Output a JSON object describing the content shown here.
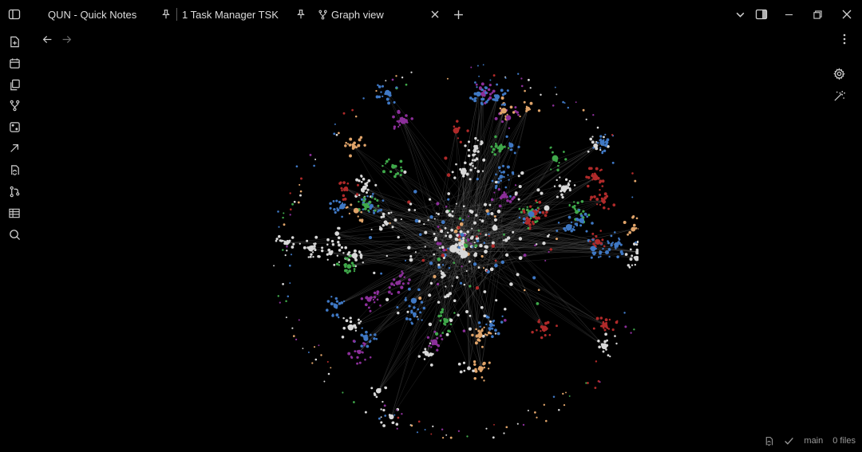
{
  "tabs": [
    {
      "label": "QUN - Quick Notes",
      "pinned": true,
      "active": false
    },
    {
      "label": "1 Task Manager TSK",
      "pinned": true,
      "active": false
    },
    {
      "label": "Graph view",
      "pinned": false,
      "active": true
    }
  ],
  "icons": {
    "sidebar_toggle": "sidebar-left-icon",
    "pin": "pin-icon",
    "graph_tab": "git-fork-icon",
    "close_tab": "close-icon",
    "new_tab": "plus-icon",
    "tab_list": "chevron-down-icon",
    "right_sidebar": "sidebar-right-icon",
    "minimize": "minimize-icon",
    "restore": "restore-icon",
    "close_window": "close-icon"
  },
  "ribbon": [
    {
      "name": "new-note",
      "icon": "file-plus-icon"
    },
    {
      "name": "daily-note",
      "icon": "calendar-icon"
    },
    {
      "name": "templates",
      "icon": "files-icon"
    },
    {
      "name": "graph-view",
      "icon": "git-fork-icon"
    },
    {
      "name": "random-note",
      "icon": "dice-icon"
    },
    {
      "name": "open-link",
      "icon": "arrow-up-right-icon"
    },
    {
      "name": "sync",
      "icon": "file-sync-icon"
    },
    {
      "name": "git",
      "icon": "git-branch-icon"
    },
    {
      "name": "table",
      "icon": "table-icon"
    },
    {
      "name": "search",
      "icon": "search-icon"
    }
  ],
  "nav": {
    "back_icon": "arrow-left-icon",
    "forward_icon": "arrow-right-icon",
    "more_icon": "more-vertical-icon"
  },
  "graph_controls": {
    "settings_icon": "gear-icon",
    "animate_icon": "magic-wand-icon"
  },
  "graph": {
    "palette": {
      "note": "#d8d8d8",
      "blue": "#3f78c4",
      "purple": "#8c2f9a",
      "green": "#3fa84a",
      "red": "#b02a2a",
      "orange": "#e0a46a",
      "link": "#6a6a6a"
    },
    "background": "#000000"
  },
  "status": {
    "branch": "main",
    "files": "0 files",
    "sync_icon": "file-sync-icon",
    "check_icon": "check-icon"
  }
}
